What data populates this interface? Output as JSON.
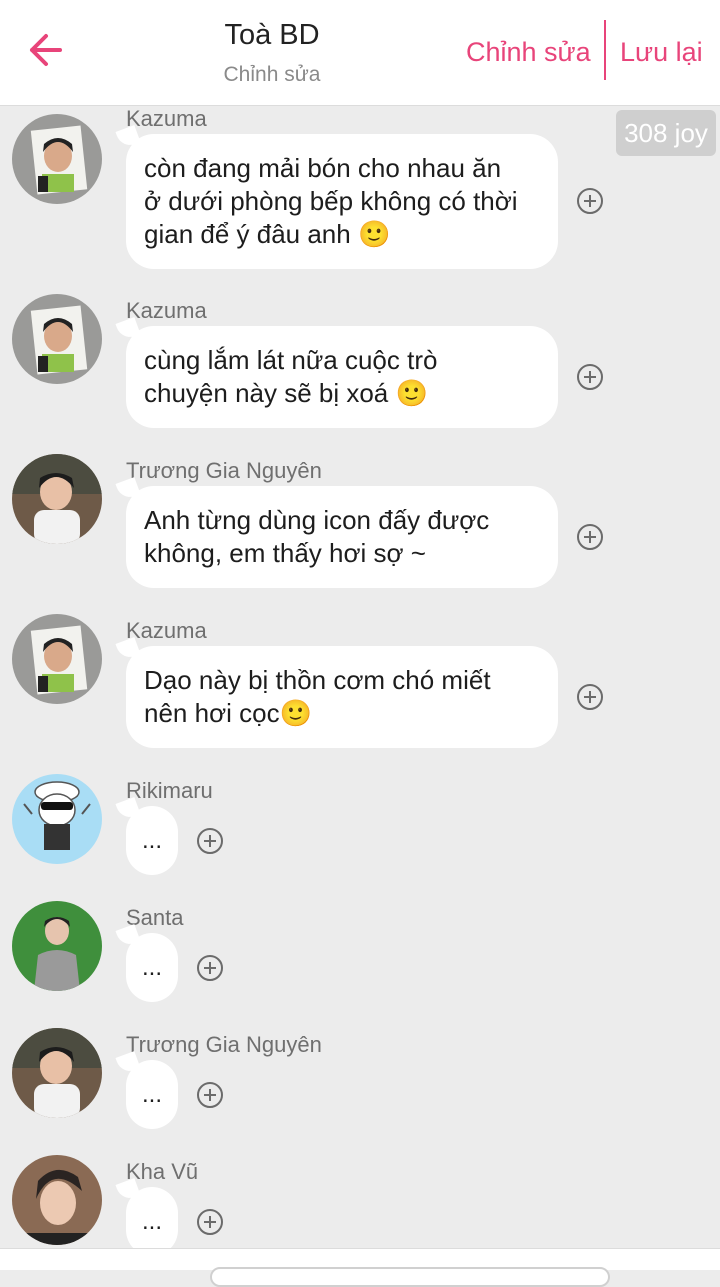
{
  "header": {
    "title": "Toà BD",
    "subtitle": "Chỉnh sửa",
    "edit_label": "Chỉnh sửa",
    "save_label": "Lưu lại",
    "accent_color": "#e8447a"
  },
  "joy_badge": "308 joy",
  "messages": [
    {
      "sender": "Kazuma",
      "text": "còn đang mải bón cho nhau ăn\nở dưới phòng bếp không có thời\ngian để ý đâu anh 🙂",
      "avatar": "kazuma-avatar"
    },
    {
      "sender": "Kazuma",
      "text": "cùng lắm lát nữa cuộc trò\nchuyện này sẽ bị xoá 🙂",
      "avatar": "kazuma-avatar"
    },
    {
      "sender": "Trương Gia Nguyên",
      "text": "Anh từng dùng icon đấy được\nkhông, em thấy hơi sợ ~",
      "avatar": "truong-gia-nguyen-avatar"
    },
    {
      "sender": "Kazuma",
      "text": "Dạo này bị thồn cơm chó miết\nnên hơi cọc🙂",
      "avatar": "kazuma-avatar"
    },
    {
      "sender": "Rikimaru",
      "text": "...",
      "avatar": "rikimaru-avatar"
    },
    {
      "sender": "Santa",
      "text": "...",
      "avatar": "santa-avatar"
    },
    {
      "sender": "Trương Gia Nguyên",
      "text": "...",
      "avatar": "truong-gia-nguyen-avatar"
    },
    {
      "sender": "Kha Vũ",
      "text": "...",
      "avatar": "kha-vu-avatar"
    }
  ]
}
